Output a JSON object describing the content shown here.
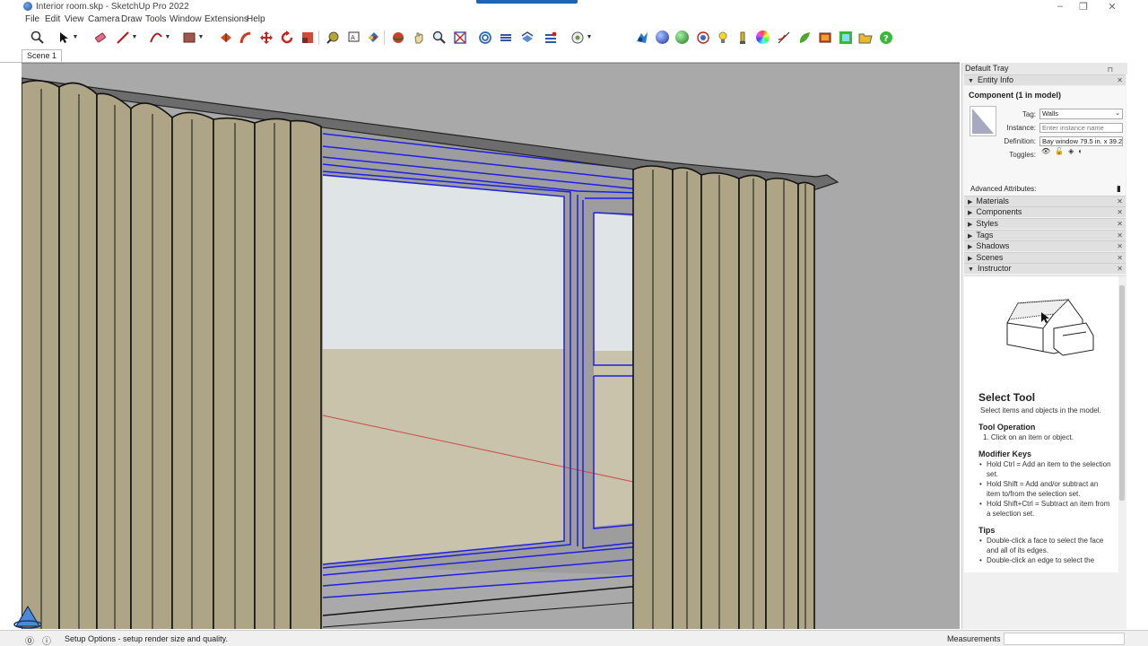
{
  "window": {
    "title": "Interior room.skp - SketchUp Pro 2022",
    "minimize": "–",
    "maximize": "❐",
    "close": "✕"
  },
  "menu": [
    "File",
    "Edit",
    "View",
    "Camera",
    "Draw",
    "Tools",
    "Window",
    "Extensions",
    "Help"
  ],
  "toolbar": {
    "left_tools": [
      "zoom-extents",
      "select",
      "eraser",
      "line",
      "arc",
      "shape",
      "push-pull",
      "follow-me",
      "move",
      "rotate",
      "scale",
      "tape-measure",
      "text",
      "paint",
      "orbit",
      "pan",
      "zoom",
      "zoom-window",
      "offset",
      "section",
      "section-fill",
      "section-display",
      "styles"
    ],
    "right_tools": [
      "extension-a",
      "render-blue",
      "render-green",
      "render-settings",
      "light",
      "light-tool",
      "color-picker",
      "curve",
      "leaf",
      "image",
      "render-film",
      "folder",
      "help"
    ]
  },
  "scene_tab": "Scene 1",
  "tray": {
    "title": "Default Tray",
    "pin": "⊓",
    "entity_info": {
      "header": "Entity Info",
      "component": "Component (1 in model)",
      "tag_label": "Tag:",
      "tag_value": "Walls",
      "instance_label": "Instance:",
      "instance_placeholder": "Enter instance name",
      "definition_label": "Definition:",
      "definition_value": "Bay window 79.5 in. x 39.2",
      "toggles_label": "Toggles:",
      "advanced": "Advanced Attributes:"
    },
    "panels": [
      "Materials",
      "Components",
      "Styles",
      "Tags",
      "Shadows",
      "Scenes"
    ],
    "instructor": {
      "header": "Instructor",
      "title": "Select Tool",
      "desc": "Select items and objects in the model.",
      "op_title": "Tool Operation",
      "op_steps": [
        "1. Click on an item or object."
      ],
      "mod_title": "Modifier Keys",
      "mods": [
        "Hold Ctrl = Add an item to the selection set.",
        "Hold Shift = Add and/or subtract an item to/from the selection set.",
        "Hold Shift+Ctrl = Subtract an item from a selection set."
      ],
      "tips_title": "Tips",
      "tips": [
        "Double-click a face to select the face and all of its edges.",
        "Double-click an edge to select the"
      ]
    }
  },
  "status": {
    "text": "Setup Options - setup render size and quality.",
    "measurements_label": "Measurements",
    "measurements_value": ""
  },
  "colors": {
    "curtain": "#aea587",
    "selection": "#1e1ee6",
    "sky": "#dfe4e6",
    "ground": "#c8c3aa",
    "axis": "#c84b4b",
    "background": "#a9a9a9"
  }
}
